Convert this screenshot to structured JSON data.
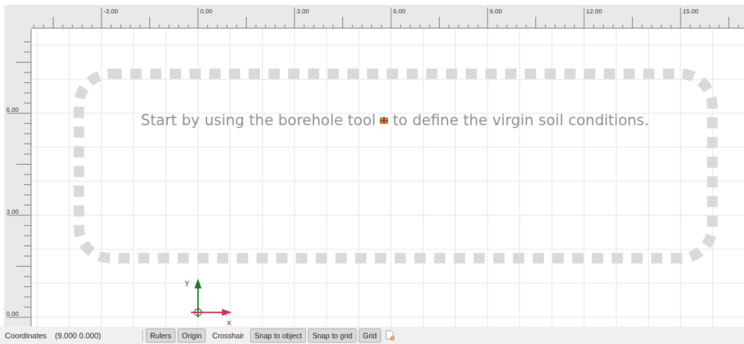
{
  "rulers": {
    "top_labels": [
      "-3.00",
      "0.00",
      "3.00",
      "6.00",
      "9.00",
      "12.00",
      "15.00"
    ],
    "left_labels": [
      "6.00",
      "3.00",
      "0.00"
    ]
  },
  "canvas": {
    "hint_before": "Start by using the borehole tool",
    "hint_after": "to define the virgin soil conditions.",
    "axis_y": "Y",
    "axis_x": "X"
  },
  "status_bar": {
    "label": "Coordinates",
    "value": "(9.000 0.000)",
    "toggles": [
      {
        "label": "Rulers",
        "on": true
      },
      {
        "label": "Origin",
        "on": true
      },
      {
        "label": "Crosshair",
        "on": false
      },
      {
        "label": "Snap to object",
        "on": true
      },
      {
        "label": "Snap to grid",
        "on": true
      },
      {
        "label": "Grid",
        "on": true
      }
    ]
  }
}
